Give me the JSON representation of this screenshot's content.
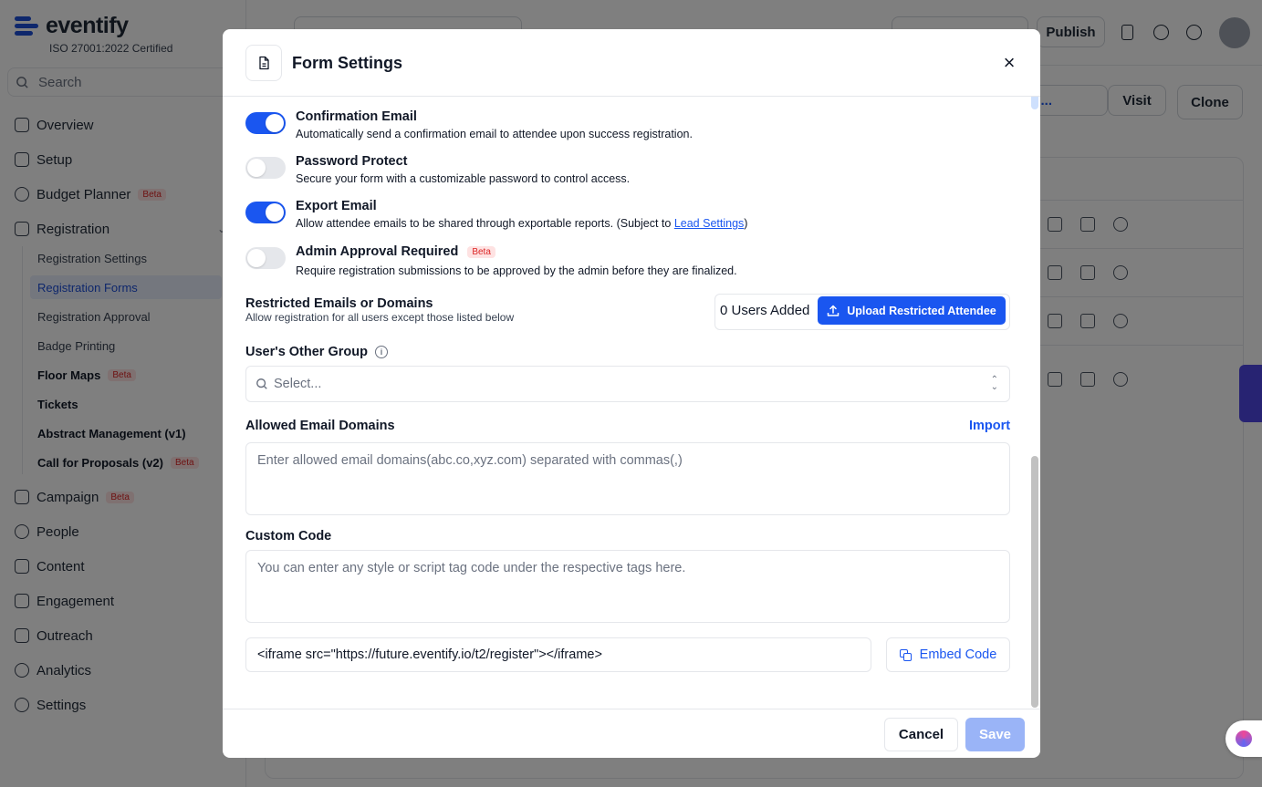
{
  "sidebar": {
    "logo_text": "eventify",
    "logo_sub": "ISO 27001:2022 Certified",
    "search_placeholder": "Search",
    "beta_label": "Beta",
    "items": [
      {
        "label": "Overview"
      },
      {
        "label": "Setup"
      },
      {
        "label": "Budget Planner"
      },
      {
        "label": "Registration"
      },
      {
        "label": "Campaign"
      },
      {
        "label": "People"
      },
      {
        "label": "Content"
      },
      {
        "label": "Engagement"
      },
      {
        "label": "Outreach"
      },
      {
        "label": "Analytics"
      },
      {
        "label": "Settings"
      }
    ],
    "sub_items": [
      {
        "label": "Registration Settings"
      },
      {
        "label": "Registration Forms"
      },
      {
        "label": "Registration Approval"
      },
      {
        "label": "Badge Printing"
      },
      {
        "label": "Floor Maps"
      },
      {
        "label": "Tickets"
      },
      {
        "label": "Abstract Management (v1)"
      },
      {
        "label": "Call for Proposals (v2)"
      }
    ]
  },
  "topbar": {
    "publish_label": "Publish",
    "visit_label": "Visit",
    "clone_label": "Clone",
    "regi_label": "regi..."
  },
  "modal": {
    "title": "Form Settings",
    "options": [
      {
        "title": "Confirmation Email",
        "desc": "Automatically send a confirmation email to attendee upon success registration.",
        "enabled": true
      },
      {
        "title": "Password Protect",
        "desc": "Secure your form with a customizable password to control access.",
        "enabled": false
      },
      {
        "title": "Export Email",
        "desc": "Allow attendee emails to be shared through exportable reports. (Subject to ",
        "link": "Lead Settings",
        "desc_after": ")",
        "enabled": true
      },
      {
        "title": "Admin Approval Required",
        "badge": "Beta",
        "desc": "Require registration submissions to be approved by the admin before they are finalized.",
        "enabled": false
      }
    ],
    "restricted": {
      "title": "Restricted Emails or Domains",
      "subtitle": "Allow registration for all users except those listed below",
      "count_label": "0 Users Added",
      "upload_label": "Upload Restricted Attendee"
    },
    "other_group": {
      "title": "User's Other Group",
      "placeholder": "Select..."
    },
    "allowed_domains": {
      "title": "Allowed Email Domains",
      "import_label": "Import",
      "placeholder": "Enter allowed email domains(abc.co,xyz.com) separated with commas(,)"
    },
    "custom_code": {
      "title": "Custom Code",
      "placeholder": "You can enter any style or script tag code under the respective tags here."
    },
    "embed": {
      "value": "<iframe src=\"https://future.eventify.io/t2/register\"></iframe>",
      "button_label": "Embed Code"
    },
    "footer": {
      "cancel_label": "Cancel",
      "save_label": "Save"
    }
  },
  "colors": {
    "accent": "#1a56f0",
    "save_disabled": "#9ab4f7",
    "overlay": "rgba(0,0,0,0.5)"
  }
}
